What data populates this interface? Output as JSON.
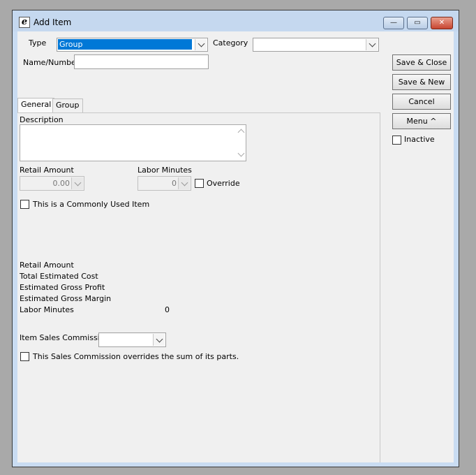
{
  "window": {
    "title": "Add Item",
    "icon": "app-e-icon"
  },
  "controls": {
    "minimize": "—",
    "maximize": "▭",
    "close": "✕"
  },
  "form": {
    "type_label": "Type",
    "type_value": "Group",
    "category_label": "Category",
    "category_value": "",
    "name_label": "Name/Number",
    "name_value": ""
  },
  "buttons": {
    "save_close": "Save & Close",
    "save_new": "Save & New",
    "cancel": "Cancel",
    "menu": "Menu ^"
  },
  "inactive_label": "Inactive",
  "tabs": [
    {
      "label": "General"
    },
    {
      "label": "Group"
    }
  ],
  "general": {
    "description_label": "Description",
    "description_value": "",
    "retail_amount_label": "Retail Amount",
    "retail_amount_value": "0.00",
    "labor_minutes_label": "Labor Minutes",
    "labor_minutes_value": "0",
    "override_label": "Override",
    "common_item_label": "This is a Commonly Used Item"
  },
  "summary": {
    "retail_amount": "Retail Amount",
    "total_estimated_cost": "Total Estimated Cost",
    "estimated_gross_profit": "Estimated Gross Profit",
    "estimated_gross_margin": "Estimated Gross Margin",
    "labor_minutes": "Labor Minutes",
    "labor_minutes_value": "0"
  },
  "commission": {
    "label": "Item Sales Commission",
    "value": "",
    "override_label": "This Sales Commission overrides the sum of its parts."
  }
}
